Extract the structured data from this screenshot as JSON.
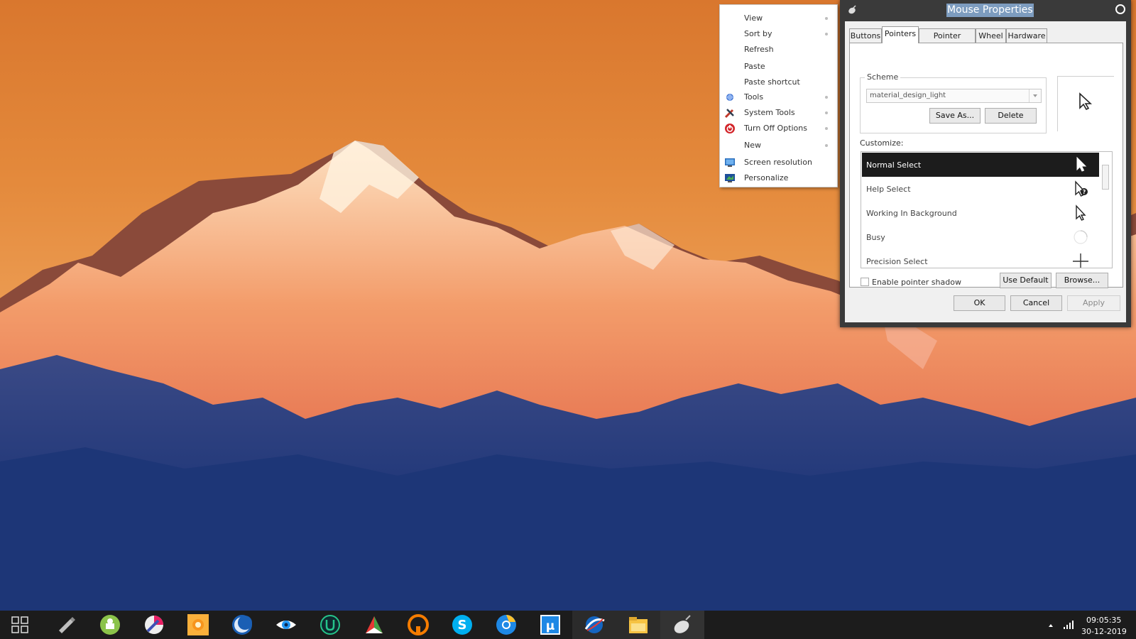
{
  "context_menu": {
    "items": [
      {
        "label": "View",
        "submenu": true
      },
      {
        "label": "Sort by",
        "submenu": true
      },
      {
        "label": "Refresh",
        "submenu": false
      },
      {
        "label": "Paste",
        "submenu": false
      },
      {
        "label": "Paste shortcut",
        "submenu": false
      },
      {
        "label": "Tools",
        "submenu": true,
        "icon": "tools-icon"
      },
      {
        "label": "System Tools",
        "submenu": true,
        "icon": "system-tools-icon"
      },
      {
        "label": "Turn Off Options",
        "submenu": true,
        "icon": "power-icon"
      },
      {
        "label": "New",
        "submenu": true
      },
      {
        "label": "Screen resolution",
        "submenu": false,
        "icon": "monitor-icon"
      },
      {
        "label": "Personalize",
        "submenu": false,
        "icon": "personalize-icon"
      }
    ]
  },
  "window": {
    "title": "Mouse Properties",
    "tabs": [
      "Buttons",
      "Pointers",
      "Pointer Options",
      "Wheel",
      "Hardware"
    ],
    "active_tab": "Pointers",
    "scheme": {
      "group_label": "Scheme",
      "selected": "material_design_light",
      "save_as_label": "Save As...",
      "delete_label": "Delete"
    },
    "customize_label": "Customize:",
    "cursor_list": [
      {
        "label": "Normal Select",
        "icon": "arrow-cursor-icon",
        "selected": true
      },
      {
        "label": "Help Select",
        "icon": "help-cursor-icon",
        "selected": false
      },
      {
        "label": "Working In Background",
        "icon": "working-cursor-icon",
        "selected": false
      },
      {
        "label": "Busy",
        "icon": "busy-cursor-icon",
        "selected": false
      },
      {
        "label": "Precision Select",
        "icon": "crosshair-cursor-icon",
        "selected": false
      }
    ],
    "enable_shadow_label": "Enable pointer shadow",
    "enable_shadow_checked": false,
    "use_default_label": "Use Default",
    "browse_label": "Browse...",
    "ok_label": "OK",
    "cancel_label": "Cancel",
    "apply_label": "Apply"
  },
  "taskbar": {
    "apps": [
      "start-grid-icon",
      "usb-icon",
      "android-icon",
      "paint-icon",
      "photos-icon",
      "moon-app-icon",
      "eye-app-icon",
      "u-app-icon",
      "pdf-app-icon",
      "vpn-app-icon",
      "skype-icon",
      "chrome-icon",
      "utorrent-icon",
      "browser-icon",
      "file-explorer-icon",
      "mouse-icon"
    ],
    "time": "09:05:35",
    "date": "30-12-2019"
  },
  "colors": {
    "title_highlight": "#7d9cbf",
    "window_frame": "#3a3a3a",
    "selected_row": "#1c1c1c",
    "taskbar": "#1c1c1c"
  }
}
